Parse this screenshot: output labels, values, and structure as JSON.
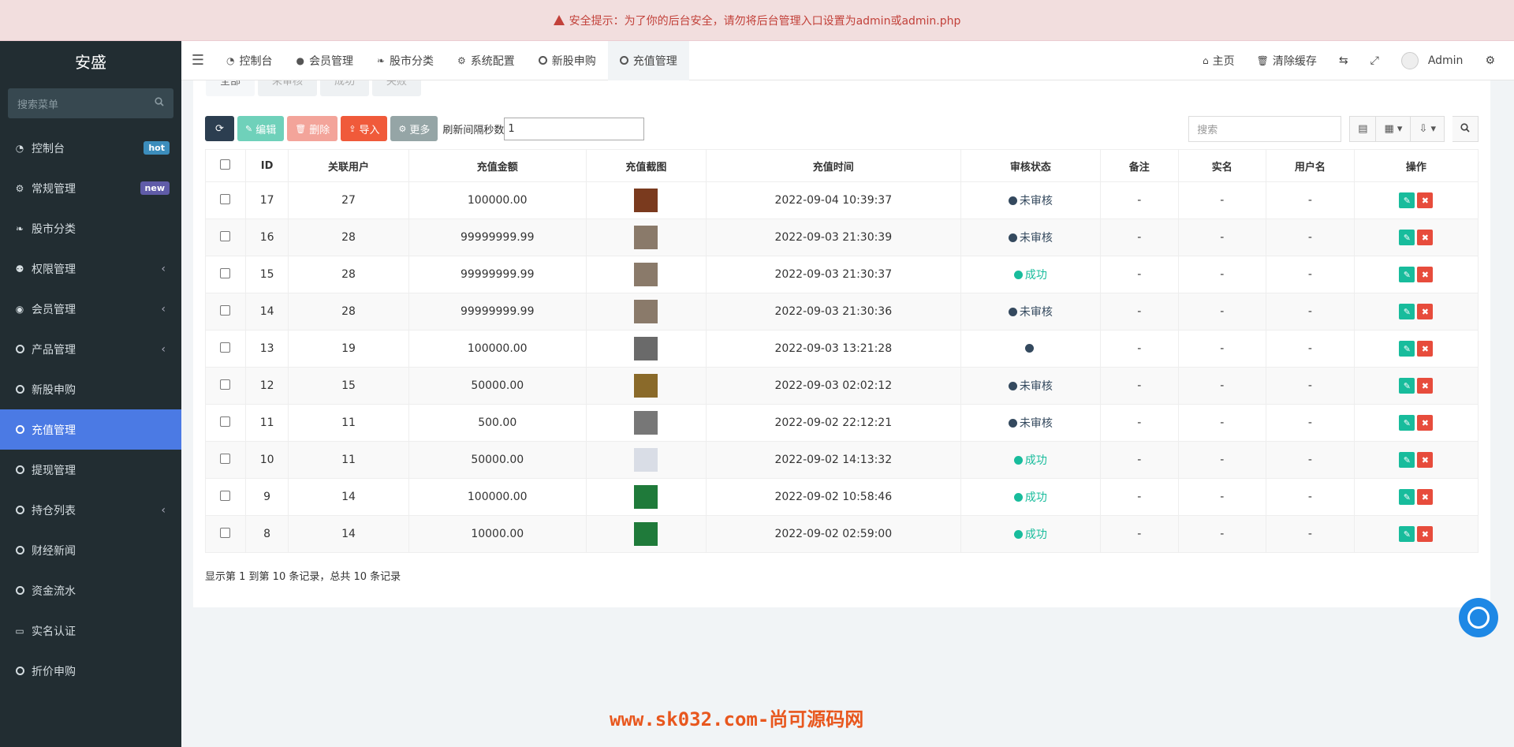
{
  "alert": {
    "text": "安全提示：为了你的后台安全，请勿将后台管理入口设置为admin或admin.php"
  },
  "sidebar": {
    "logo": "安盛",
    "search_placeholder": "搜索菜单",
    "items": [
      {
        "label": "控制台",
        "icon": "dashboard-icon",
        "badge": "hot",
        "badge_color": "#3c8dbc"
      },
      {
        "label": "常规管理",
        "icon": "cogs-icon",
        "badge": "new",
        "badge_color": "#605ca8"
      },
      {
        "label": "股市分类",
        "icon": "leaf-icon"
      },
      {
        "label": "权限管理",
        "icon": "group-icon",
        "chevron": "‹"
      },
      {
        "label": "会员管理",
        "icon": "user-circle-icon",
        "chevron": "‹"
      },
      {
        "label": "产品管理",
        "icon": "circle-icon",
        "chevron": "‹"
      },
      {
        "label": "新股申购",
        "icon": "circle-icon"
      },
      {
        "label": "充值管理",
        "icon": "circle-icon",
        "active": true
      },
      {
        "label": "提现管理",
        "icon": "circle-icon"
      },
      {
        "label": "持仓列表",
        "icon": "circle-icon",
        "chevron": "‹"
      },
      {
        "label": "财经新闻",
        "icon": "circle-icon"
      },
      {
        "label": "资金流水",
        "icon": "circle-icon"
      },
      {
        "label": "实名认证",
        "icon": "credit-card-icon"
      },
      {
        "label": "折价申购",
        "icon": "circle-icon"
      }
    ]
  },
  "topbar": {
    "tabs": [
      {
        "label": "控制台",
        "icon": "dashboard-icon"
      },
      {
        "label": "会员管理",
        "icon": "user-icon"
      },
      {
        "label": "股市分类",
        "icon": "leaf-icon"
      },
      {
        "label": "系统配置",
        "icon": "gear-icon"
      },
      {
        "label": "新股申购",
        "icon": "circle-icon"
      },
      {
        "label": "充值管理",
        "icon": "circle-icon",
        "active": true
      }
    ],
    "right": {
      "home": "主页",
      "clear_cache": "清除缓存",
      "user": "Admin"
    }
  },
  "subtabs": [
    "全部",
    "未审核",
    "成功",
    "失败"
  ],
  "toolbar": {
    "edit": "编辑",
    "delete": "删除",
    "import": "导入",
    "more": "更多",
    "refresh_label": "刷新间隔秒数",
    "refresh_value": "1",
    "search_placeholder": "搜索"
  },
  "table": {
    "headers": [
      "ID",
      "关联用户",
      "充值金额",
      "充值截图",
      "充值时间",
      "审核状态",
      "备注",
      "实名",
      "用户名",
      "操作"
    ],
    "rows": [
      {
        "id": "17",
        "user": "27",
        "amount": "100000.00",
        "time": "2022-09-04 10:39:37",
        "status": "未审核",
        "status_type": "pending",
        "remark": "-",
        "realname": "-",
        "username": "-",
        "thumb": "#7a3a1e"
      },
      {
        "id": "16",
        "user": "28",
        "amount": "99999999.99",
        "time": "2022-09-03 21:30:39",
        "status": "未审核",
        "status_type": "pending",
        "remark": "-",
        "realname": "-",
        "username": "-",
        "thumb": "#8a7a6a"
      },
      {
        "id": "15",
        "user": "28",
        "amount": "99999999.99",
        "time": "2022-09-03 21:30:37",
        "status": "成功",
        "status_type": "ok",
        "remark": "-",
        "realname": "-",
        "username": "-",
        "thumb": "#8a7a6a"
      },
      {
        "id": "14",
        "user": "28",
        "amount": "99999999.99",
        "time": "2022-09-03 21:30:36",
        "status": "未审核",
        "status_type": "pending",
        "remark": "-",
        "realname": "-",
        "username": "-",
        "thumb": "#8a7a6a"
      },
      {
        "id": "13",
        "user": "19",
        "amount": "100000.00",
        "time": "2022-09-03 13:21:28",
        "status": "",
        "status_type": "pending",
        "remark": "-",
        "realname": "-",
        "username": "-",
        "thumb": "#6a6a6a"
      },
      {
        "id": "12",
        "user": "15",
        "amount": "50000.00",
        "time": "2022-09-03 02:02:12",
        "status": "未审核",
        "status_type": "pending",
        "remark": "-",
        "realname": "-",
        "username": "-",
        "thumb": "#8a6a2a"
      },
      {
        "id": "11",
        "user": "11",
        "amount": "500.00",
        "time": "2022-09-02 22:12:21",
        "status": "未审核",
        "status_type": "pending",
        "remark": "-",
        "realname": "-",
        "username": "-",
        "thumb": "#777777"
      },
      {
        "id": "10",
        "user": "11",
        "amount": "50000.00",
        "time": "2022-09-02 14:13:32",
        "status": "成功",
        "status_type": "ok",
        "remark": "-",
        "realname": "-",
        "username": "-",
        "thumb": "#d9dde6"
      },
      {
        "id": "9",
        "user": "14",
        "amount": "100000.00",
        "time": "2022-09-02 10:58:46",
        "status": "成功",
        "status_type": "ok",
        "remark": "-",
        "realname": "-",
        "username": "-",
        "thumb": "#1f7a3a"
      },
      {
        "id": "8",
        "user": "14",
        "amount": "10000.00",
        "time": "2022-09-02 02:59:00",
        "status": "成功",
        "status_type": "ok",
        "remark": "-",
        "realname": "-",
        "username": "-",
        "thumb": "#1f7a3a"
      }
    ]
  },
  "footer": {
    "summary": "显示第 1 到第 10 条记录，总共 10 条记录"
  },
  "watermark": "www.sk032.com-尚可源码网",
  "colors": {
    "sidebar_bg": "#222d32",
    "active": "#4b7ae4",
    "pending": "#34495e",
    "success": "#18bc9c"
  }
}
